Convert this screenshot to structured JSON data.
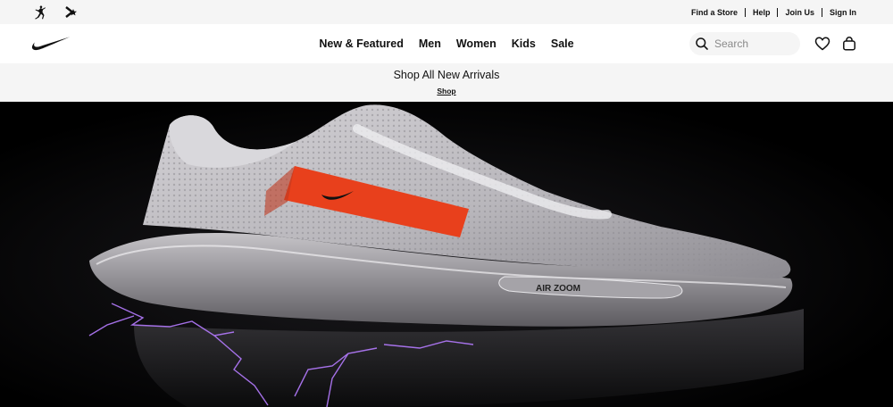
{
  "utility_bar": {
    "brand_icons": [
      "jordan-jumpman-icon",
      "converse-star-chevron-icon"
    ],
    "links": [
      {
        "label": "Find a Store"
      },
      {
        "label": "Help"
      },
      {
        "label": "Join Us"
      },
      {
        "label": "Sign In"
      }
    ]
  },
  "header": {
    "logo": "nike-swoosh-logo",
    "menu": [
      {
        "label": "New & Featured"
      },
      {
        "label": "Men"
      },
      {
        "label": "Women"
      },
      {
        "label": "Kids"
      },
      {
        "label": "Sale"
      }
    ],
    "search": {
      "placeholder": "Search",
      "value": ""
    },
    "icons": [
      "search-icon",
      "heart-icon",
      "bag-icon"
    ]
  },
  "promo": {
    "title": "Shop All New Arrivals",
    "link": "Shop"
  },
  "hero": {
    "shoe_badge_text": "AIR ZOOM",
    "colors": {
      "background": "#000000",
      "shoe": "#c9c7cc",
      "accent_panel": "#e8401c",
      "lightning": "#b57bff"
    }
  }
}
